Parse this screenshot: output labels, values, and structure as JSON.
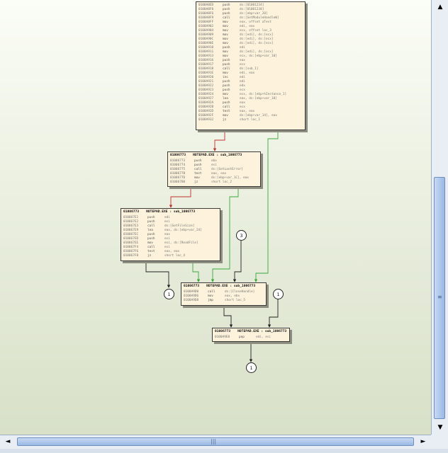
{
  "colors": {
    "edge_true": "#3aa83a",
    "edge_false": "#c03030",
    "edge_normal": "#202020"
  },
  "nodes": {
    "n1": {
      "lines": [
        [
          "0100A8ED",
          "push",
          "ds:[01001234]"
        ],
        [
          "0100A8F0",
          "push",
          "ds:[01001238]"
        ],
        [
          "0100A8F6",
          "push",
          "ds:[ebp+var_20]"
        ],
        [
          "0100A8F9",
          "call",
          "ds:[GetModuleHandleW]"
        ],
        [
          "0100A8FF",
          "mov",
          "eax, offset aTest"
        ],
        [
          "0100A902",
          "mov",
          "edi, eax"
        ],
        [
          "0100A904",
          "mov",
          "ecx, offset loc_3"
        ],
        [
          "0100A909",
          "mov",
          "ds:[edi], ds:[ecx]"
        ],
        [
          "0100A90C",
          "mov",
          "ds:[edi], ds:[ecx]"
        ],
        [
          "0100A90E",
          "mov",
          "ds:[edi], ds:[ecx]"
        ],
        [
          "0100A910",
          "push",
          "edi"
        ],
        [
          "0100A911",
          "mov",
          "ds:[edi], ds:[ecx]"
        ],
        [
          "0100A913",
          "mov",
          "ecx, ds:[ebp+var_10]"
        ],
        [
          "0100A916",
          "push",
          "eax"
        ],
        [
          "0100A917",
          "push",
          "ecx"
        ],
        [
          "0100A918",
          "call",
          "ds:[sub_1]"
        ],
        [
          "0100A91E",
          "mov",
          "edi, eax"
        ],
        [
          "0100A920",
          "inc",
          "edi"
        ],
        [
          "0100A921",
          "push",
          "edi"
        ],
        [
          "0100A922",
          "push",
          "edx"
        ],
        [
          "0100A923",
          "push",
          "ecx"
        ],
        [
          "0100A924",
          "mov",
          "ecx, ds:[ebp+hInstance_1]"
        ],
        [
          "0100A927",
          "lea",
          "eax, ds:[ebp+var_18]"
        ],
        [
          "0100A92A",
          "push",
          "eax"
        ],
        [
          "0100A92B",
          "call",
          "ecx"
        ],
        [
          "0100A92D",
          "test",
          "eax, eax"
        ],
        [
          "0100A92F",
          "mov",
          "ds:[ebp+var_14], eax"
        ],
        [
          "0100A932",
          "jz",
          "short loc_1"
        ]
      ]
    },
    "n2": {
      "header": [
        "01006773",
        "NOTEPAD.EXE : sub_1006773"
      ],
      "lines": [
        [
          "01006773",
          "push",
          "ebx"
        ],
        [
          "01006774",
          "push",
          "esi"
        ],
        [
          "01006775",
          "call",
          "ds:[GetLastError]"
        ],
        [
          "0100677B",
          "test",
          "eax, eax"
        ],
        [
          "0100677D",
          "mov",
          "ds:[ebp+var_1C], eax"
        ],
        [
          "01006780",
          "jz",
          "short loc_2"
        ]
      ]
    },
    "n3": {
      "header": [
        "01006773",
        "NOTEPAD.EXE : sub_1006773"
      ],
      "lines": [
        [
          "010067E1",
          "push",
          "edi"
        ],
        [
          "010067E2",
          "push",
          "esi"
        ],
        [
          "010067E3",
          "call",
          "ds:[GetFileSize]"
        ],
        [
          "010067E9",
          "lea",
          "eax, ds:[ebp+var_24]"
        ],
        [
          "010067EC",
          "push",
          "eax"
        ],
        [
          "010067ED",
          "push",
          "esi"
        ],
        [
          "010067EE",
          "mov",
          "esi, ds:[ReadFile]"
        ],
        [
          "010067F4",
          "call",
          "esi"
        ],
        [
          "010067F6",
          "test",
          "eax, eax"
        ],
        [
          "010067F8",
          "jz",
          "short loc_4"
        ]
      ]
    },
    "n4": {
      "header": [
        "01006773",
        "NOTEPAD.EXE : sub_1006773"
      ],
      "lines": [
        [
          "0100A9D0",
          "call",
          "ds:[CloseHandle]"
        ],
        [
          "0100A9D6",
          "mov",
          "eax, ebx"
        ],
        [
          "0100A9D8",
          "jmp",
          "short loc_5"
        ]
      ]
    },
    "n5": {
      "header": [
        "01006773",
        "NOTEPAD.EXE : sub_1006773"
      ],
      "lines": [
        [
          "0100A9E0",
          "pop",
          "edi, esi"
        ]
      ]
    }
  },
  "refs": {
    "r1": "1",
    "r2": "3",
    "r3": "1",
    "r4": "1"
  },
  "scroll": {
    "up": "▲",
    "down": "▼",
    "left": "◄",
    "right": "►",
    "grip_v": "≡",
    "grip_h": "|||"
  }
}
